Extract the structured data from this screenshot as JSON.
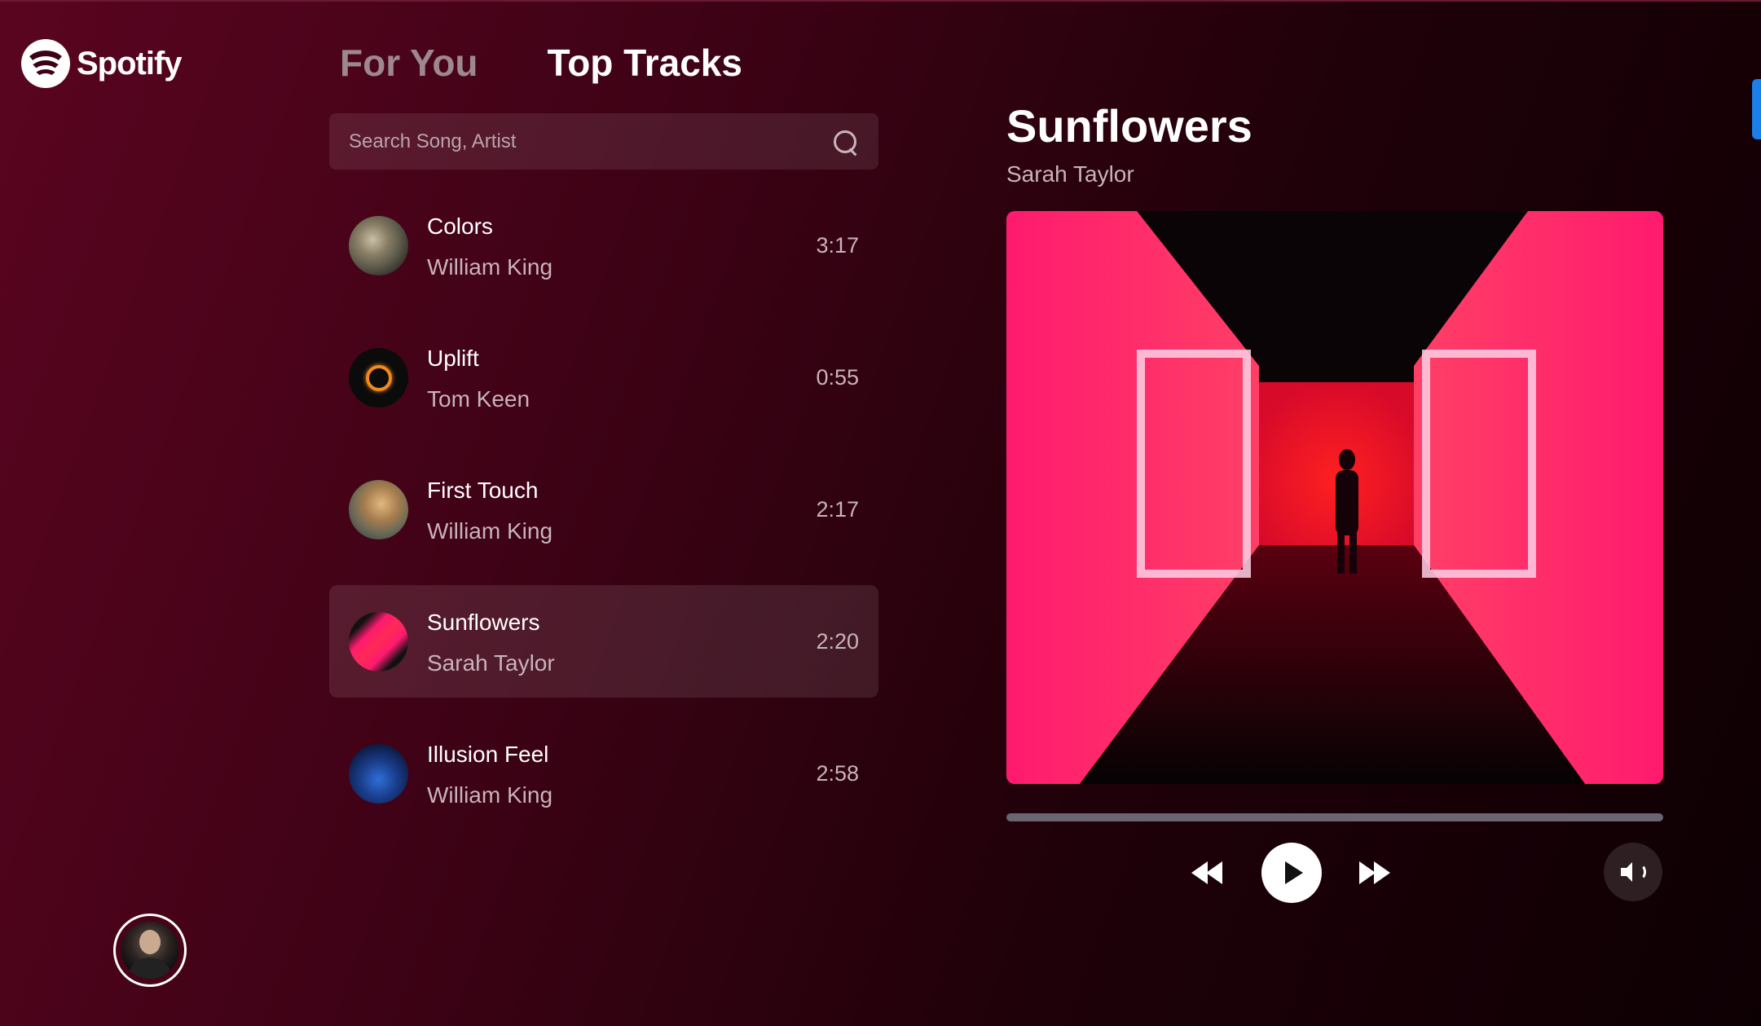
{
  "brand": {
    "name": "Spotify"
  },
  "tabs": [
    {
      "label": "For You",
      "active": false
    },
    {
      "label": "Top Tracks",
      "active": true
    }
  ],
  "search": {
    "placeholder": "Search Song, Artist",
    "value": ""
  },
  "tracks": [
    {
      "title": "Colors",
      "artist": "William King",
      "duration": "3:17",
      "selected": false
    },
    {
      "title": "Uplift",
      "artist": "Tom Keen",
      "duration": "0:55",
      "selected": false
    },
    {
      "title": "First Touch",
      "artist": "William King",
      "duration": "2:17",
      "selected": false
    },
    {
      "title": "Sunflowers",
      "artist": "Sarah Taylor",
      "duration": "2:20",
      "selected": true
    },
    {
      "title": "Illusion Feel",
      "artist": "William King",
      "duration": "2:58",
      "selected": false
    }
  ],
  "now_playing": {
    "title": "Sunflowers",
    "artist": "Sarah Taylor",
    "progress": 0
  },
  "icons": {
    "search": "search-icon",
    "rewind": "rewind-icon",
    "play": "play-icon",
    "fast_forward": "fast-forward-icon",
    "volume": "volume-icon"
  },
  "colors": {
    "background_start": "#5a0520",
    "background_end": "#0d0003",
    "accent": "#1a7fe8"
  }
}
